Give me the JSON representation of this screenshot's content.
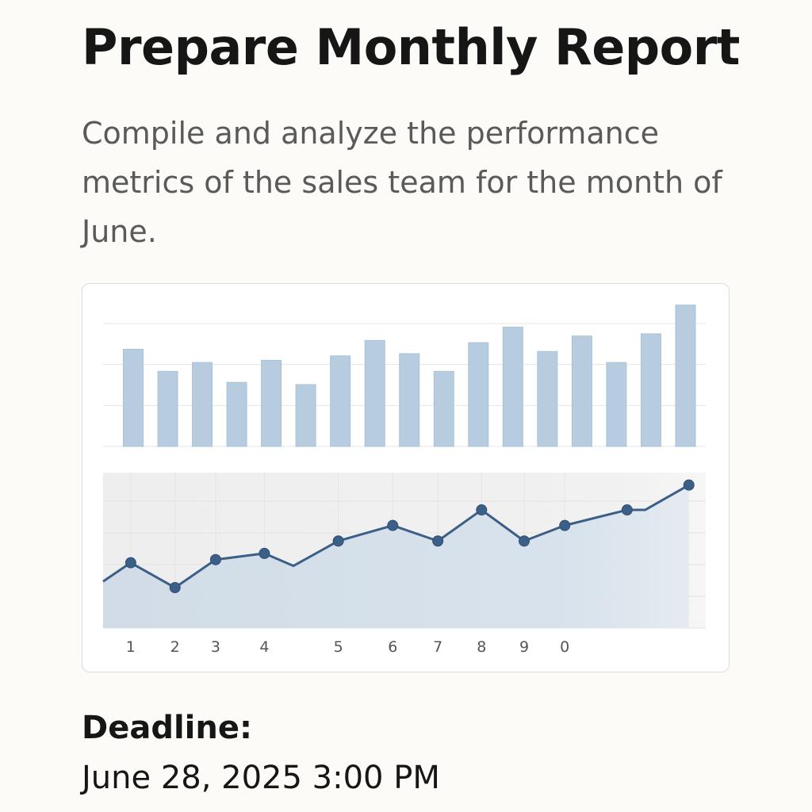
{
  "task": {
    "title": "Prepare Monthly Report",
    "description": "Compile and analyze the performance metrics of the sales team for the month of June.",
    "deadline_label": "Deadline:",
    "deadline_value": "June 28, 2025 3:00 PM"
  },
  "colors": {
    "background": "#fcfbf7",
    "bar": "#b7cddf",
    "line": "#3b5f86",
    "area": "#d3dfea",
    "grid": "#e6e6e6"
  },
  "chart_data": [
    {
      "type": "bar",
      "title": "",
      "xlabel": "",
      "ylabel": "",
      "grid": true,
      "ylim": [
        0,
        7
      ],
      "values": [
        4.4,
        3.4,
        3.8,
        2.9,
        3.9,
        2.8,
        4.1,
        4.8,
        4.2,
        3.4,
        4.7,
        5.4,
        4.3,
        5.0,
        3.8,
        5.1,
        6.4
      ]
    },
    {
      "type": "area",
      "title": "",
      "xlabel": "",
      "ylabel": "",
      "grid": true,
      "ylim": [
        0,
        5
      ],
      "x": [
        0,
        1,
        2,
        3,
        4,
        5,
        6,
        7,
        8,
        9,
        10,
        11,
        12,
        13,
        14,
        15,
        16
      ],
      "values": [
        1.5,
        2.1,
        1.3,
        2.2,
        2.4,
        2.0,
        2.8,
        3.3,
        2.8,
        3.8,
        2.8,
        3.3,
        3.8,
        3.8,
        4.6
      ],
      "x_positions": [
        0.0,
        0.98,
        2.55,
        3.99,
        5.72,
        6.75,
        8.34,
        10.27,
        11.87,
        13.42,
        14.93,
        16.37,
        18.58,
        19.22,
        20.77
      ],
      "markers": [
        false,
        true,
        true,
        true,
        true,
        false,
        true,
        true,
        true,
        true,
        true,
        true,
        true,
        false,
        true
      ],
      "tick_labels": [
        "1",
        "2",
        "3",
        "4",
        "5",
        "6",
        "7",
        "8",
        "9",
        "0"
      ],
      "tick_positions": [
        0.98,
        2.55,
        3.99,
        5.72,
        8.34,
        10.27,
        11.87,
        13.42,
        14.93,
        16.37
      ],
      "xlim": [
        0,
        21.2
      ]
    }
  ]
}
